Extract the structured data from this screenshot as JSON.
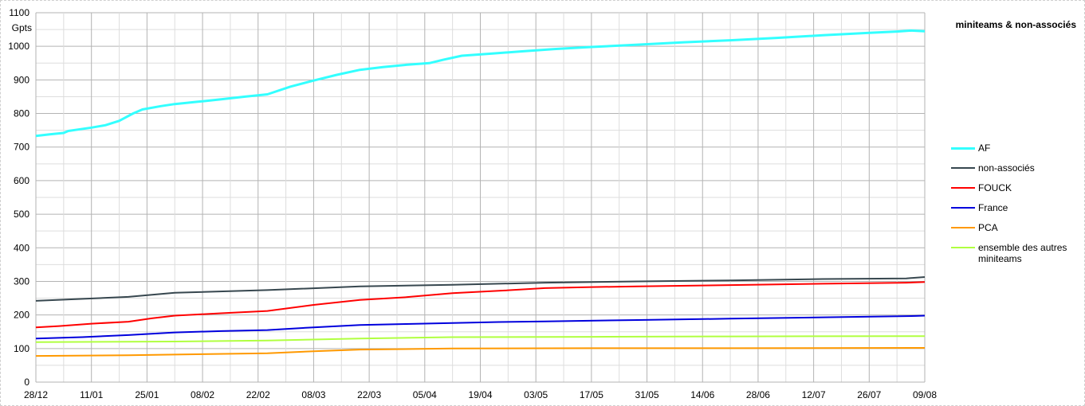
{
  "chart_data": {
    "type": "line",
    "title": "miniteams & non-associés",
    "ylabel": "Gpts",
    "ylim": [
      0,
      1100
    ],
    "yticks": [
      0,
      100,
      200,
      300,
      400,
      500,
      600,
      700,
      800,
      900,
      1000,
      1100
    ],
    "x_labels": [
      "28/12",
      "11/01",
      "25/01",
      "08/02",
      "22/02",
      "08/03",
      "22/03",
      "05/04",
      "19/04",
      "03/05",
      "17/05",
      "31/05",
      "14/06",
      "28/06",
      "12/07",
      "26/07",
      "09/08"
    ],
    "grid": true,
    "legend_position": "right",
    "series": [
      {
        "name": "AF",
        "color": "#33ffff",
        "width": 3,
        "points": [
          [
            0,
            733
          ],
          [
            3,
            738
          ],
          [
            6,
            742
          ],
          [
            7,
            748
          ],
          [
            9,
            752
          ],
          [
            12,
            758
          ],
          [
            15,
            765
          ],
          [
            18,
            778
          ],
          [
            21,
            800
          ],
          [
            23,
            812
          ],
          [
            27,
            822
          ],
          [
            30,
            828
          ],
          [
            35,
            835
          ],
          [
            40,
            842
          ],
          [
            45,
            850
          ],
          [
            50,
            857
          ],
          [
            55,
            880
          ],
          [
            60,
            898
          ],
          [
            65,
            915
          ],
          [
            70,
            930
          ],
          [
            75,
            938
          ],
          [
            80,
            945
          ],
          [
            85,
            950
          ],
          [
            88,
            960
          ],
          [
            92,
            972
          ],
          [
            98,
            978
          ],
          [
            105,
            985
          ],
          [
            112,
            992
          ],
          [
            120,
            998
          ],
          [
            130,
            1005
          ],
          [
            140,
            1012
          ],
          [
            150,
            1018
          ],
          [
            160,
            1025
          ],
          [
            170,
            1033
          ],
          [
            180,
            1040
          ],
          [
            186,
            1044
          ],
          [
            189,
            1047
          ],
          [
            192,
            1045
          ]
        ]
      },
      {
        "name": "non-associés",
        "color": "#37474f",
        "width": 2,
        "points": [
          [
            0,
            242
          ],
          [
            20,
            254
          ],
          [
            30,
            266
          ],
          [
            50,
            274
          ],
          [
            70,
            285
          ],
          [
            90,
            290
          ],
          [
            110,
            296
          ],
          [
            130,
            300
          ],
          [
            150,
            303
          ],
          [
            170,
            307
          ],
          [
            188,
            309
          ],
          [
            192,
            313
          ]
        ]
      },
      {
        "name": "FOUCK",
        "color": "#ff0000",
        "width": 2,
        "points": [
          [
            0,
            163
          ],
          [
            5,
            167
          ],
          [
            12,
            174
          ],
          [
            20,
            180
          ],
          [
            25,
            190
          ],
          [
            30,
            198
          ],
          [
            40,
            205
          ],
          [
            50,
            212
          ],
          [
            60,
            230
          ],
          [
            70,
            245
          ],
          [
            80,
            253
          ],
          [
            90,
            265
          ],
          [
            100,
            272
          ],
          [
            110,
            280
          ],
          [
            120,
            283
          ],
          [
            130,
            285
          ],
          [
            150,
            289
          ],
          [
            170,
            293
          ],
          [
            188,
            296
          ],
          [
            192,
            298
          ]
        ]
      },
      {
        "name": "France",
        "color": "#0000dd",
        "width": 2,
        "points": [
          [
            0,
            130
          ],
          [
            10,
            134
          ],
          [
            20,
            140
          ],
          [
            30,
            148
          ],
          [
            40,
            152
          ],
          [
            50,
            155
          ],
          [
            60,
            163
          ],
          [
            70,
            170
          ],
          [
            80,
            173
          ],
          [
            90,
            176
          ],
          [
            100,
            179
          ],
          [
            110,
            181
          ],
          [
            130,
            185
          ],
          [
            150,
            189
          ],
          [
            170,
            193
          ],
          [
            190,
            197
          ],
          [
            192,
            198
          ]
        ]
      },
      {
        "name": "PCA",
        "color": "#ff9900",
        "width": 2,
        "points": [
          [
            0,
            78
          ],
          [
            20,
            80
          ],
          [
            30,
            82
          ],
          [
            50,
            86
          ],
          [
            60,
            92
          ],
          [
            70,
            97
          ],
          [
            90,
            100
          ],
          [
            120,
            101
          ],
          [
            150,
            101
          ],
          [
            192,
            102
          ]
        ]
      },
      {
        "name": "ensemble des autres miniteams",
        "color": "#b0ff40",
        "width": 2,
        "points": [
          [
            0,
            119
          ],
          [
            30,
            121
          ],
          [
            50,
            124
          ],
          [
            70,
            130
          ],
          [
            90,
            134
          ],
          [
            120,
            135
          ],
          [
            150,
            136
          ],
          [
            192,
            137
          ]
        ]
      }
    ]
  }
}
